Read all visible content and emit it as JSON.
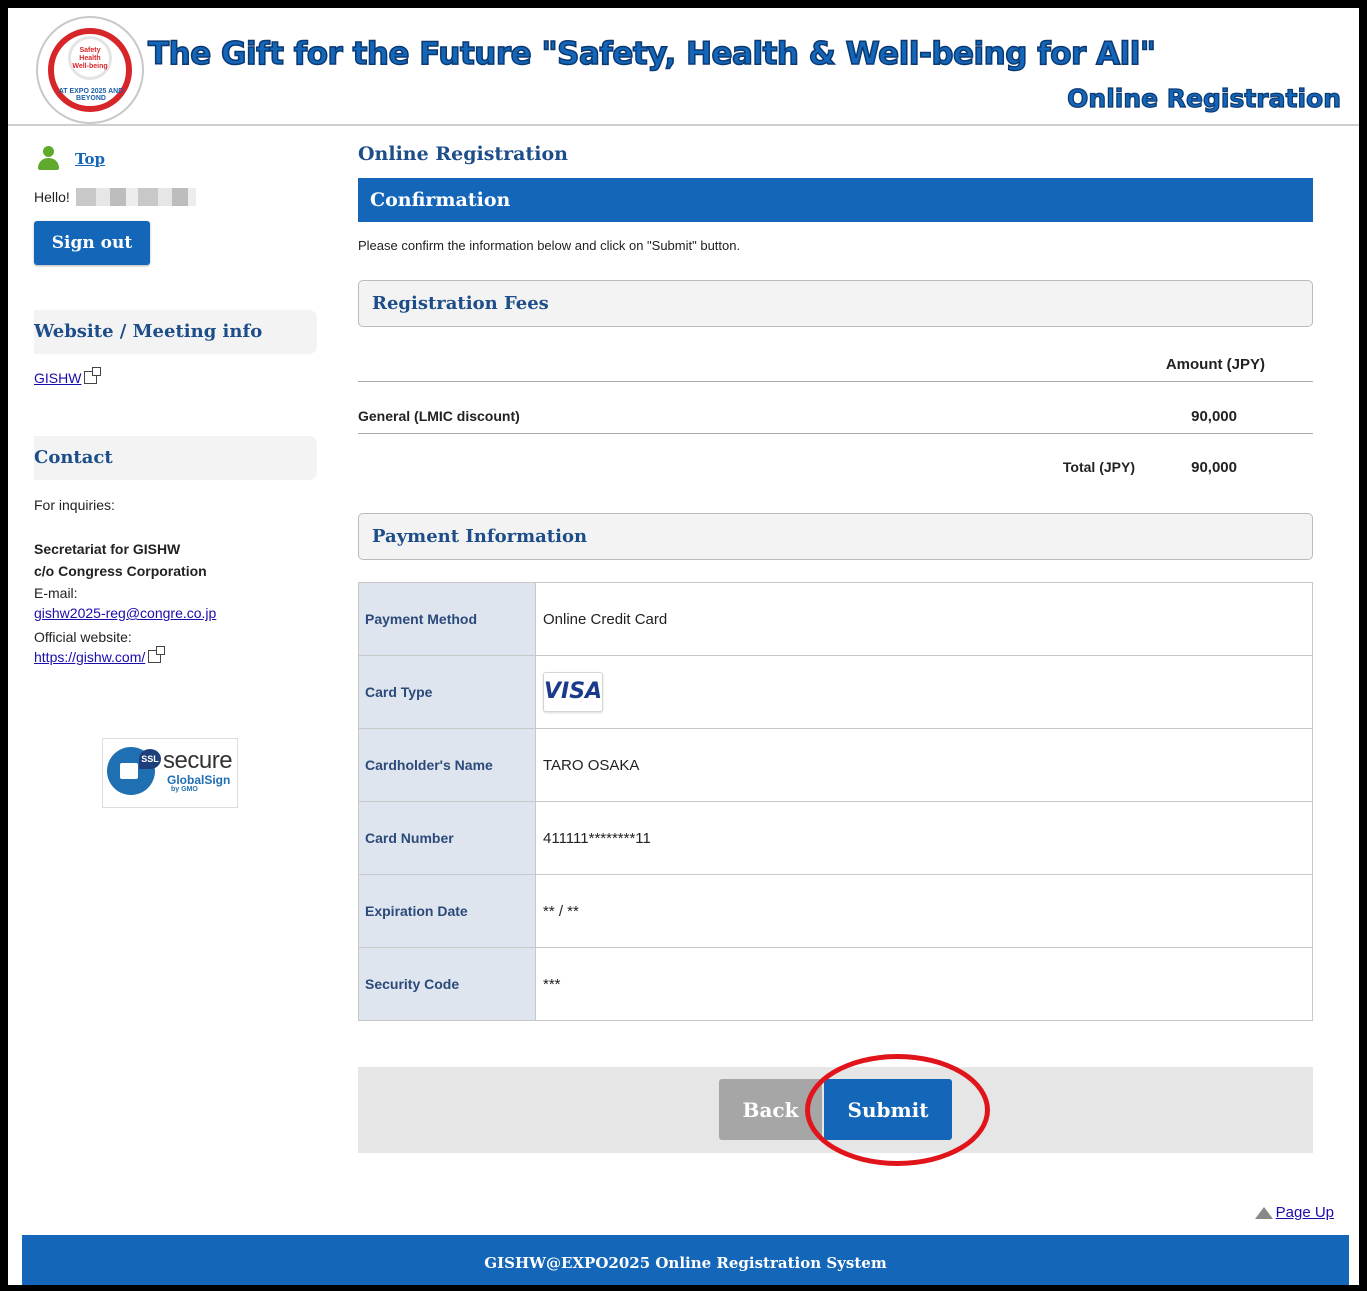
{
  "header": {
    "title": "The Gift for the Future \"Safety, Health & Well-being for All\"",
    "subtitle": "Online Registration",
    "logo_text_center": "Safety Health Well-being",
    "logo_text_bottom": "AT EXPO 2025 AND BEYOND"
  },
  "sidebar": {
    "top_link": "Top",
    "hello": "Hello!",
    "signout_label": "Sign out",
    "website_heading": "Website / Meeting info",
    "website_link": "GISHW",
    "contact_heading": "Contact",
    "contact": {
      "inquiries": "For inquiries:",
      "secretariat": "Secretariat for GISHW",
      "co": "c/o Congress Corporation",
      "email_label": "E-mail:",
      "email": "gishw2025-reg@congre.co.jp",
      "website_label": "Official website:",
      "website": "https://gishw.com/"
    },
    "ssl": {
      "tag": "SSL",
      "secure": "secure",
      "globalsign": "GlobalSign",
      "gmo": "by GMO"
    }
  },
  "main": {
    "title": "Online Registration",
    "banner": "Confirmation",
    "instruction": "Please confirm the information below and click on \"Submit\" button.",
    "fees": {
      "heading": "Registration Fees",
      "amount_header": "Amount (JPY)",
      "items": [
        {
          "name": "General (LMIC discount)",
          "amount": "90,000"
        }
      ],
      "total_label": "Total (JPY)",
      "total": "90,000"
    },
    "payment": {
      "heading": "Payment Information",
      "rows": [
        {
          "label": "Payment Method",
          "value": "Online Credit Card"
        },
        {
          "label": "Card Type",
          "value": "VISA"
        },
        {
          "label": "Cardholder's Name",
          "value": "TARO OSAKA"
        },
        {
          "label": "Card Number",
          "value": "411111********11"
        },
        {
          "label": "Expiration Date",
          "value": "** / **"
        },
        {
          "label": "Security Code",
          "value": "***"
        }
      ]
    },
    "buttons": {
      "back": "Back",
      "submit": "Submit"
    }
  },
  "page_up": "Page Up",
  "footer": "GISHW@EXPO2025 Online Registration System",
  "colors": {
    "primary": "#1466b8",
    "heading": "#1d4e89",
    "highlight": "#e0141a"
  }
}
